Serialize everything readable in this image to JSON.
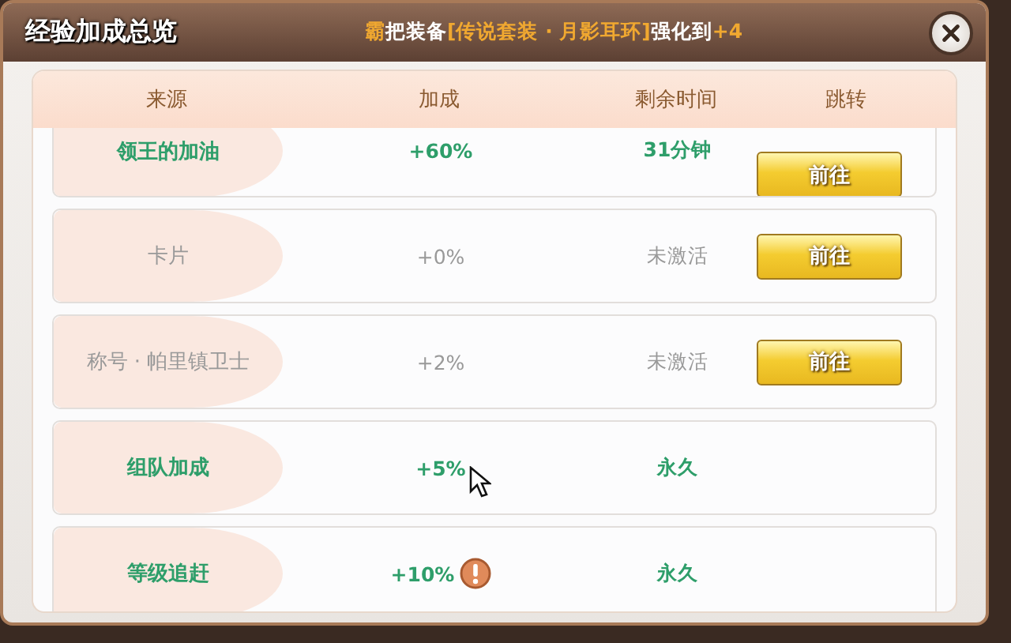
{
  "window": {
    "title": "经验加成总览"
  },
  "notice": [
    {
      "text": "霸",
      "highlight": true
    },
    {
      "text": "把装备",
      "highlight": false
    },
    {
      "text": "[传说套装 · 月影耳环]",
      "highlight": true
    },
    {
      "text": "强化到",
      "highlight": false
    },
    {
      "text": "+4",
      "highlight": true
    }
  ],
  "table": {
    "columns": [
      "来源",
      "加成",
      "剩余时间",
      "跳转"
    ],
    "rows": [
      {
        "source": "领王的加油",
        "bonus": "+60%",
        "time": "31分钟",
        "active": true,
        "warning": false,
        "button": "前往"
      },
      {
        "source": "卡片",
        "bonus": "+0%",
        "time": "未激活",
        "active": false,
        "warning": false,
        "button": "前往"
      },
      {
        "source": "称号 · 帕里镇卫士",
        "bonus": "+2%",
        "time": "未激活",
        "active": false,
        "warning": false,
        "button": "前往"
      },
      {
        "source": "组队加成",
        "bonus": "+5%",
        "time": "永久",
        "active": true,
        "warning": false
      },
      {
        "source": "等级追赶",
        "bonus": "+10%",
        "time": "永久",
        "active": true,
        "warning": true
      }
    ]
  }
}
